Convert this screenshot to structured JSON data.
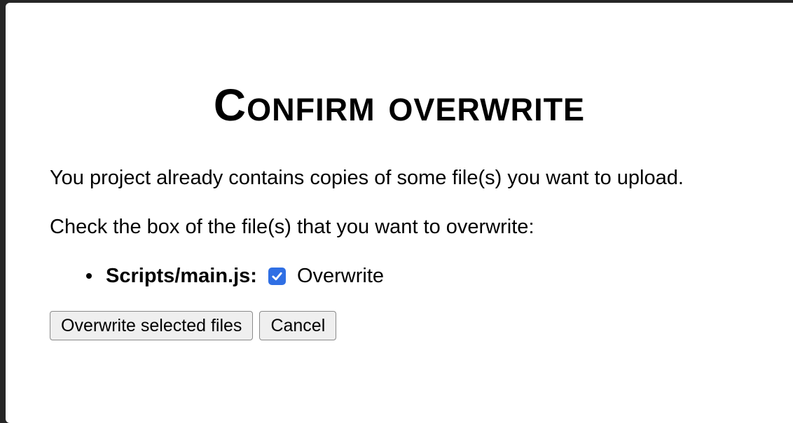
{
  "dialog": {
    "title": "Confirm overwrite",
    "message": "You project already contains copies of some file(s) you want to upload.",
    "instruction": "Check the box of the file(s) that you want to overwrite:",
    "files": [
      {
        "name": "Scripts/main.js:",
        "checked": true,
        "option_label": "Overwrite"
      }
    ],
    "buttons": {
      "confirm_label": "Overwrite selected files",
      "cancel_label": "Cancel"
    }
  },
  "colors": {
    "checkbox_accent": "#2f6fe4",
    "button_bg": "#efefef",
    "dialog_bg": "#ffffff"
  }
}
